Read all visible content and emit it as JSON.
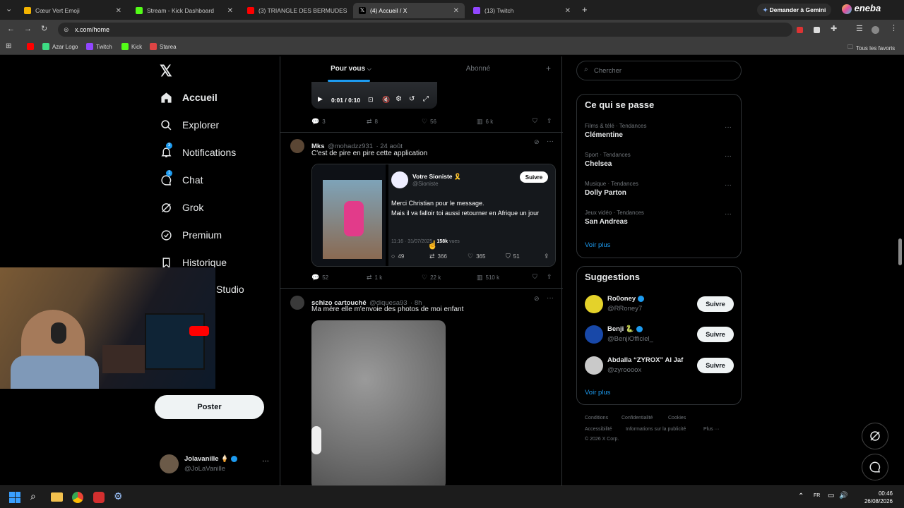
{
  "browser": {
    "tabs": [
      {
        "title": "Cœur Vert Emoji",
        "color": "#f4b400",
        "active": false
      },
      {
        "title": "Stream - Kick Dashboard",
        "color": "#53fc18",
        "active": false
      },
      {
        "title": "(3) TRIANGLE DES BERMUDES",
        "color": "#ff0000",
        "active": false
      },
      {
        "title": "(4) Accueil / X",
        "color": "#000000",
        "active": true
      },
      {
        "title": "(13) Twitch",
        "color": "#9146ff",
        "active": false
      }
    ],
    "gemini_label": "Demander à Gemini",
    "eneba_label": "eneba",
    "url": "x.com/home",
    "bookmarks": [
      {
        "label": "",
        "color": "#ff0000"
      },
      {
        "label": "Azar Logo",
        "color": "#3ddc84"
      },
      {
        "label": "Twitch",
        "color": "#9146ff"
      },
      {
        "label": "Kick",
        "color": "#53fc18"
      },
      {
        "label": "Starea",
        "color": "#d44"
      }
    ],
    "all_bookmarks_label": "Tous les favoris"
  },
  "nav": {
    "items": [
      {
        "label": "Accueil",
        "icon": "home-icon",
        "badge": ""
      },
      {
        "label": "Explorer",
        "icon": "search-icon",
        "badge": ""
      },
      {
        "label": "Notifications",
        "icon": "bell-icon",
        "badge": "3"
      },
      {
        "label": "Chat",
        "icon": "chat-icon",
        "badge": "1"
      },
      {
        "label": "Grok",
        "icon": "grok-icon",
        "badge": ""
      },
      {
        "label": "Premium",
        "icon": "premium-icon",
        "badge": ""
      },
      {
        "label": "Historique",
        "icon": "bookmark-icon",
        "badge": ""
      },
      {
        "label": "Studio",
        "icon": "studio-icon",
        "badge": ""
      }
    ],
    "post_button": "Poster",
    "account": {
      "name": "Jolavanille 🍦",
      "handle": "@JoLaVanille"
    }
  },
  "feed": {
    "tabs": [
      "Pour vous",
      "Abonné"
    ],
    "video": {
      "time": "0:01 / 0:10"
    },
    "tweet0": {
      "replies": "3",
      "retweets": "8",
      "likes": "56",
      "views": "6 k"
    },
    "tweet1": {
      "name": "Mks",
      "handle": "@mohadzz931",
      "date": "· 24 août",
      "text": "C'est de pire en pire cette application",
      "quoted": {
        "name": "Votre Sioniste 🎗️",
        "handle": "@Sioniste",
        "follow": "Suivre",
        "line1": "Merci Christian pour le message.",
        "line2": "Mais il va falloir toi aussi retourner en Afrique un jour",
        "meta_time": "11:16 · 31/07/2025 ·",
        "meta_views": "158k",
        "meta_views_label": "vues",
        "stats": [
          "49",
          "366",
          "365",
          "51"
        ]
      },
      "replies": "52",
      "retweets": "1 k",
      "likes": "22 k",
      "views": "510 k"
    },
    "tweet2": {
      "name": "schizo cartouché",
      "handle": "@diquesa93",
      "date": "· 8h",
      "text": "Ma mère elle m'envoie des photos de moi enfant"
    }
  },
  "sidebar": {
    "search_placeholder": "Chercher",
    "trends_title": "Ce qui se passe",
    "trends": [
      {
        "category": "Films & télé · Tendances",
        "name": "Clémentine"
      },
      {
        "category": "Sport · Tendances",
        "name": "Chelsea"
      },
      {
        "category": "Musique · Tendances",
        "name": "Dolly Parton"
      },
      {
        "category": "Jeux vidéo · Tendances",
        "name": "San Andreas"
      }
    ],
    "see_more": "Voir plus",
    "suggestions_title": "Suggestions",
    "suggestions": [
      {
        "name": "Ro0oney",
        "handle": "@RRoney7",
        "follow": "Suivre",
        "color": "#e4d22a"
      },
      {
        "name": "Benji 🐍",
        "handle": "@BenjiOfficiel_",
        "follow": "Suivre",
        "color": "#1848a8"
      },
      {
        "name": "Abdalla “ZYROX” Al Jaf",
        "handle": "@zyroooox",
        "follow": "Suivre",
        "color": "#c9c9c9"
      }
    ],
    "see_more2": "Voir plus",
    "footer": [
      "Conditions",
      "Confidentialité",
      "Cookies",
      "Accessibilité",
      "Informations sur la publicité",
      "Plus ···",
      "© 2026 X Corp."
    ]
  },
  "taskbar": {
    "time": "00:46",
    "date": "26/08/2026"
  }
}
